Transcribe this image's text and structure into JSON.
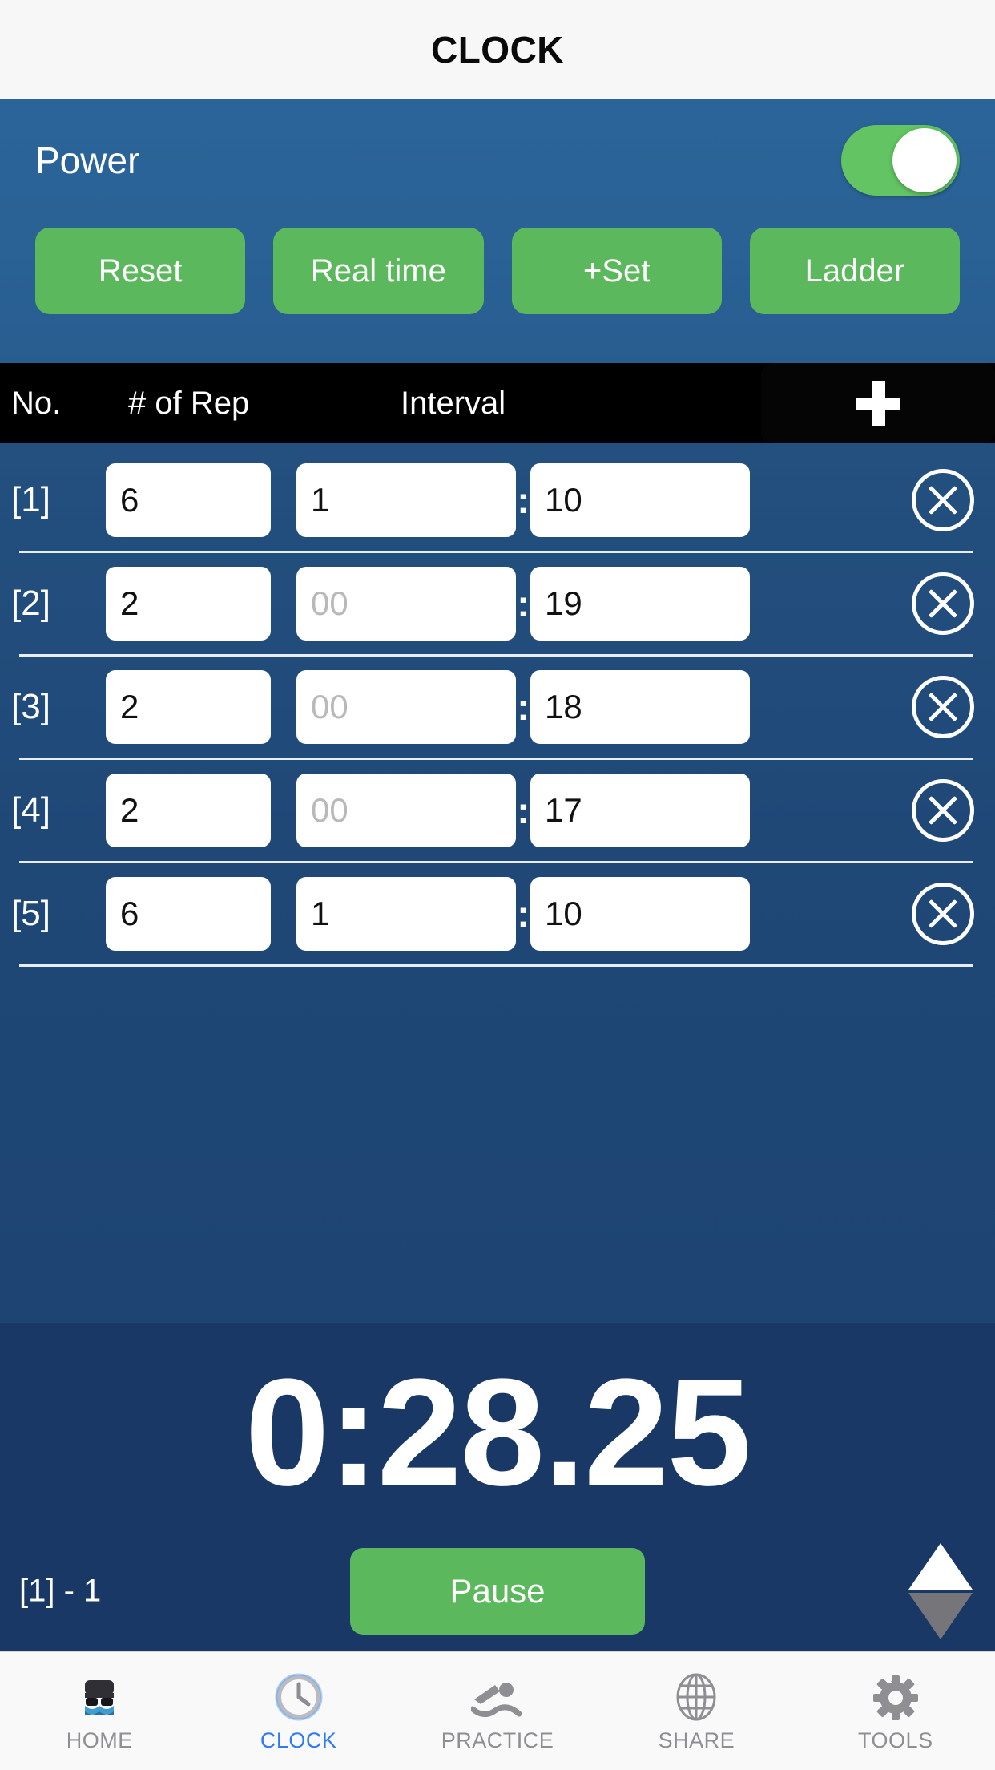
{
  "navbar": {
    "title": "CLOCK"
  },
  "power": {
    "label": "Power",
    "toggle_state": "on",
    "toggle_color": "#5cd65c"
  },
  "actions": {
    "reset": "Reset",
    "real_time": "Real time",
    "add_set": "+Set",
    "ladder": "Ladder",
    "button_color": "#5cb85c"
  },
  "table": {
    "headers": {
      "no": "No.",
      "reps": "# of Rep",
      "interval": "Interval"
    },
    "add_icon": "plus-icon",
    "header_bg": "#000000",
    "rows": [
      {
        "no": "[1]",
        "reps": "6",
        "min": "1",
        "min_placeholder": "00",
        "sec": "10",
        "delete_icon": "close-circle-icon"
      },
      {
        "no": "[2]",
        "reps": "2",
        "min": "",
        "min_placeholder": "00",
        "sec": "19",
        "delete_icon": "close-circle-icon"
      },
      {
        "no": "[3]",
        "reps": "2",
        "min": "",
        "min_placeholder": "00",
        "sec": "18",
        "delete_icon": "close-circle-icon"
      },
      {
        "no": "[4]",
        "reps": "2",
        "min": "",
        "min_placeholder": "00",
        "sec": "17",
        "delete_icon": "close-circle-icon"
      },
      {
        "no": "[5]",
        "reps": "6",
        "min": "1",
        "min_placeholder": "00",
        "sec": "10",
        "delete_icon": "close-circle-icon"
      }
    ],
    "separator": ":"
  },
  "timer": {
    "value": "0:28.25",
    "set_indicator": "[1] - 1",
    "pause_label": "Pause",
    "stepper_up": "triangle-up-icon",
    "stepper_down": "triangle-down-icon",
    "panel_color": "#1a3866"
  },
  "tabbar": {
    "active": "CLOCK",
    "tabs": [
      {
        "label": "HOME",
        "icon": "pool-icon"
      },
      {
        "label": "CLOCK",
        "icon": "clock-icon"
      },
      {
        "label": "PRACTICE",
        "icon": "swimmer-icon"
      },
      {
        "label": "SHARE",
        "icon": "globe-icon"
      },
      {
        "label": "TOOLS",
        "icon": "gear-icon"
      }
    ],
    "active_color": "#2f7bf6",
    "inactive_color": "#8e8e93"
  }
}
